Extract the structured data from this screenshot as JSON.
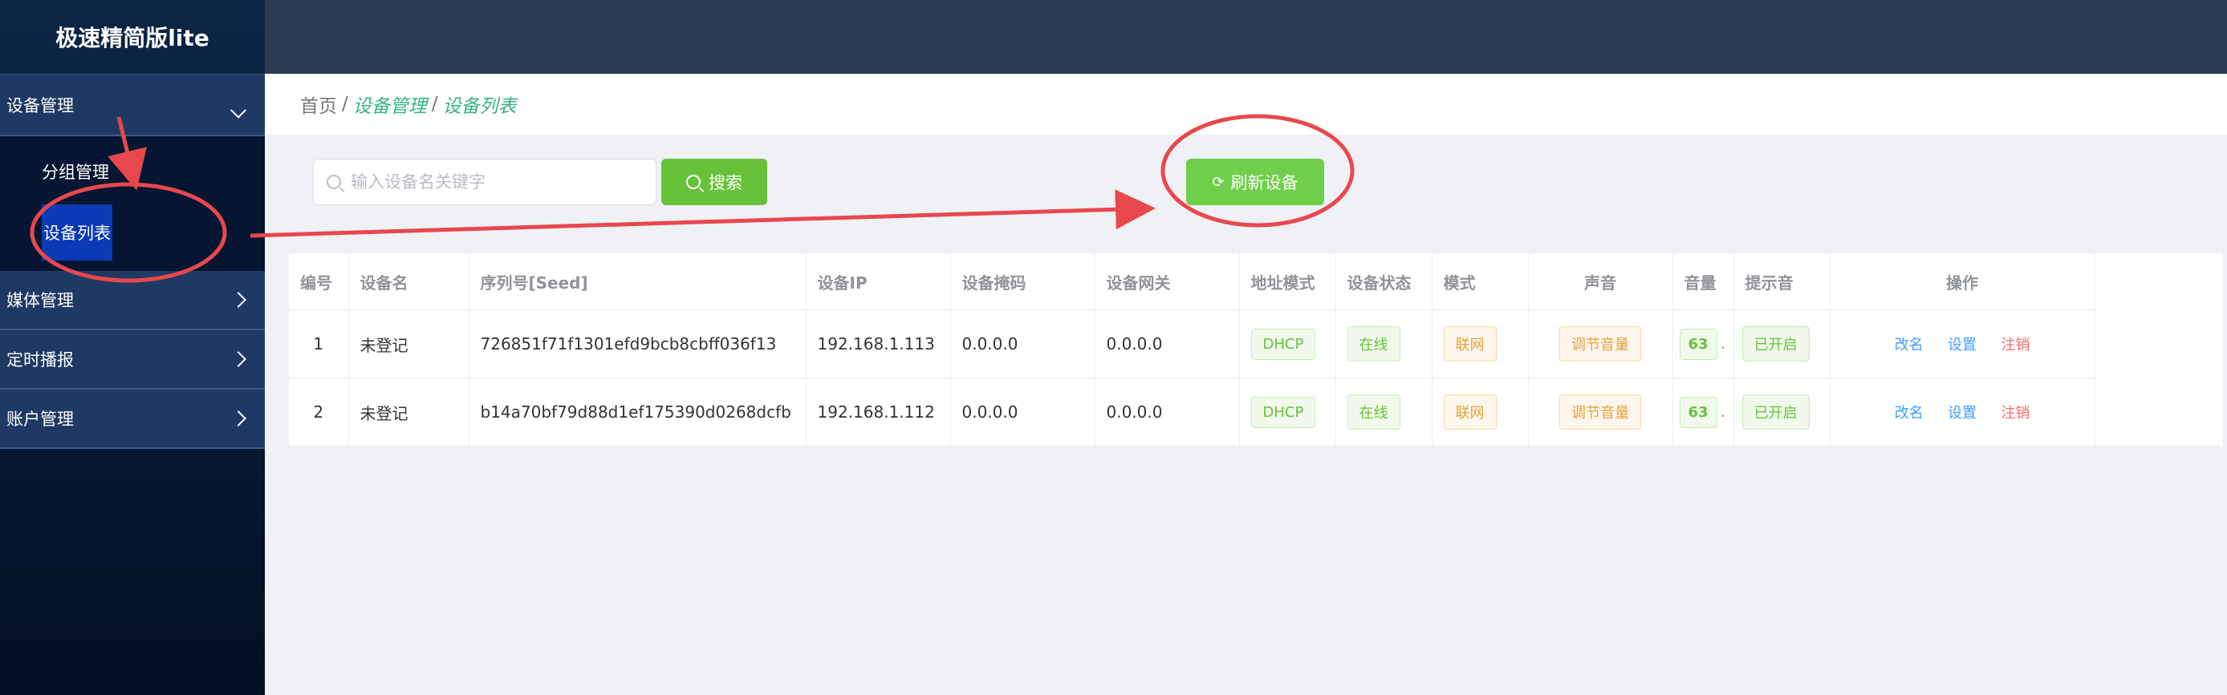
{
  "app": {
    "logo": "极速精简版lite"
  },
  "sidebar": {
    "menus": [
      {
        "label": "设备管理",
        "open": true,
        "children": [
          {
            "label": "分组管理",
            "active": false
          },
          {
            "label": "设备列表",
            "active": true
          }
        ]
      },
      {
        "label": "媒体管理"
      },
      {
        "label": "定时播报"
      },
      {
        "label": "账户管理"
      }
    ]
  },
  "breadcrumb": {
    "home": "首页",
    "sep": "/",
    "level1": "设备管理",
    "level2": "设备列表"
  },
  "toolbar": {
    "search_placeholder": "输入设备名关键字",
    "search_label": "搜索",
    "refresh_label": "刷新设备"
  },
  "table": {
    "columns": [
      "编号",
      "设备名",
      "序列号[Seed]",
      "设备IP",
      "设备掩码",
      "设备网关",
      "地址模式",
      "设备状态",
      "模式",
      "声音",
      "音量",
      "提示音",
      "操作"
    ],
    "rows": [
      {
        "no": "1",
        "name": "未登记",
        "seed": "726851f71f1301efd9bcb8cbff036f13",
        "ip": "192.168.1.113",
        "mask": "0.0.0.0",
        "gateway": "0.0.0.0",
        "addr_mode": "DHCP",
        "status": "在线",
        "mode": "联网",
        "sound": "调节音量",
        "volume": "63",
        "tone": "已开启",
        "actions": [
          "改名",
          "设置",
          "注销"
        ]
      },
      {
        "no": "2",
        "name": "未登记",
        "seed": "b14a70bf79d88d1ef175390d0268dcfb",
        "ip": "192.168.1.112",
        "mask": "0.0.0.0",
        "gateway": "0.0.0.0",
        "addr_mode": "DHCP",
        "status": "在线",
        "mode": "联网",
        "sound": "调节音量",
        "volume": "63",
        "tone": "已开启",
        "actions": [
          "改名",
          "设置",
          "注销"
        ]
      }
    ]
  },
  "colors": {
    "sidebar_bg": "#0d2546",
    "topbar_bg": "#2c3c52",
    "accent_green": "#67c23a",
    "breadcrumb_active": "#37b37e",
    "annotation_red": "#e8484d",
    "link_blue": "#409eff",
    "link_red": "#f56c6c"
  }
}
